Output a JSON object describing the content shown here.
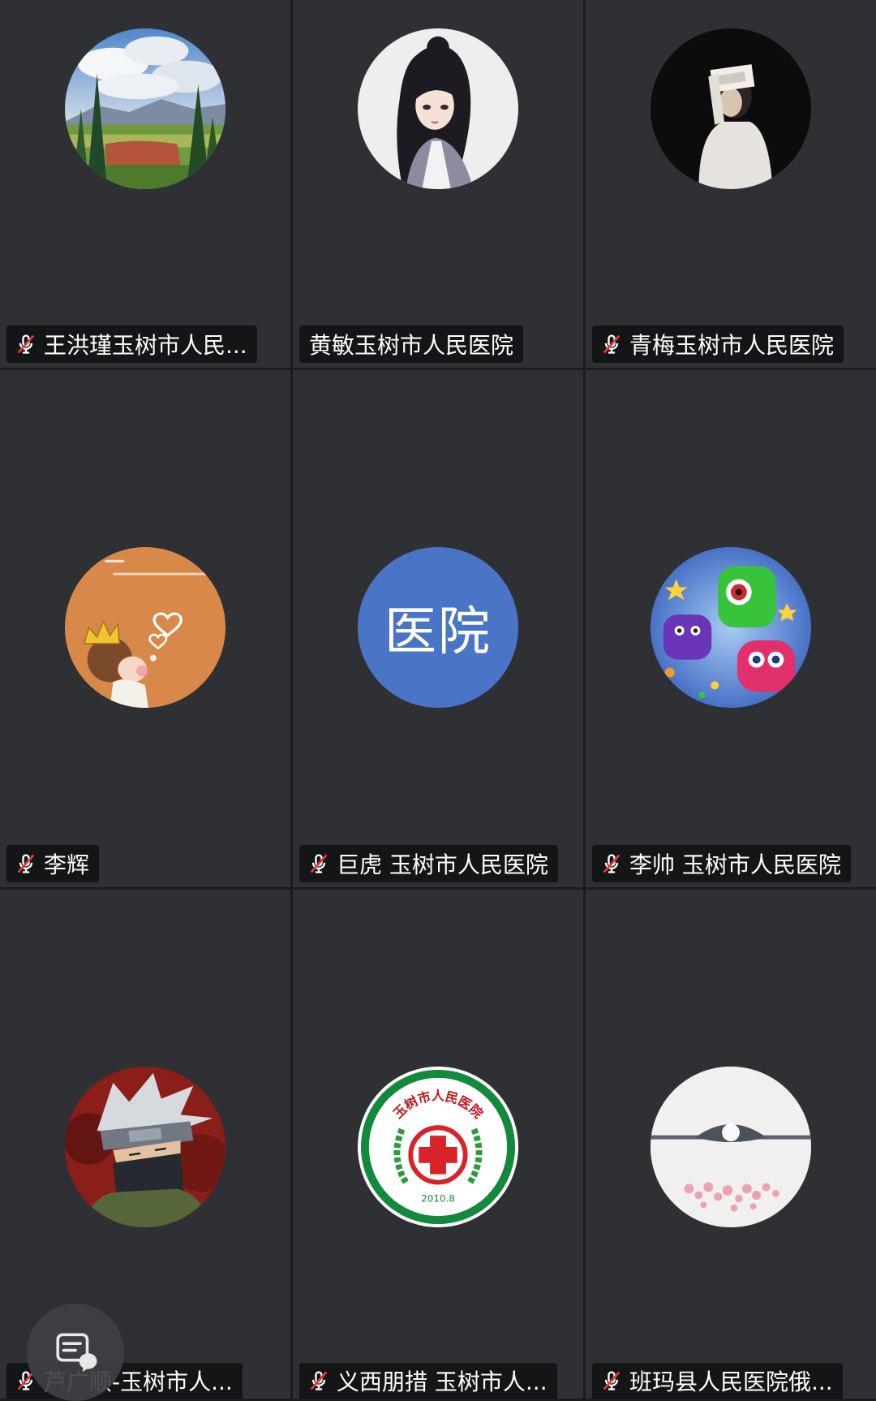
{
  "colors": {
    "page_bg": "#1b1c1f",
    "tile_bg": "#2e3034",
    "label_bg": "rgba(0,0,0,0.55)",
    "muted_slash": "#e23b3b",
    "hospital_avatar_bg": "#4a74c6"
  },
  "icons": {
    "muted": "mic-off-icon",
    "chat": "chat-icon"
  },
  "participants": [
    {
      "name": "王洪瑾玉树市人民...",
      "muted": true
    },
    {
      "name": "黄敏玉树市人民医院",
      "muted": false
    },
    {
      "name": "青梅玉树市人民医院",
      "muted": true
    },
    {
      "name": "李辉",
      "muted": true
    },
    {
      "name": "巨虎 玉树市人民医院",
      "muted": true,
      "avatar_text": "医院"
    },
    {
      "name": "李帅 玉树市人民医院",
      "muted": true
    },
    {
      "name": "芦广顺-玉树市人...",
      "muted": true
    },
    {
      "name": "义西朋措 玉树市人...",
      "muted": true,
      "logo": {
        "name": "玉树市人民医院",
        "year": "2010.8"
      }
    },
    {
      "name": "班玛县人民医院俄...",
      "muted": true
    }
  ]
}
